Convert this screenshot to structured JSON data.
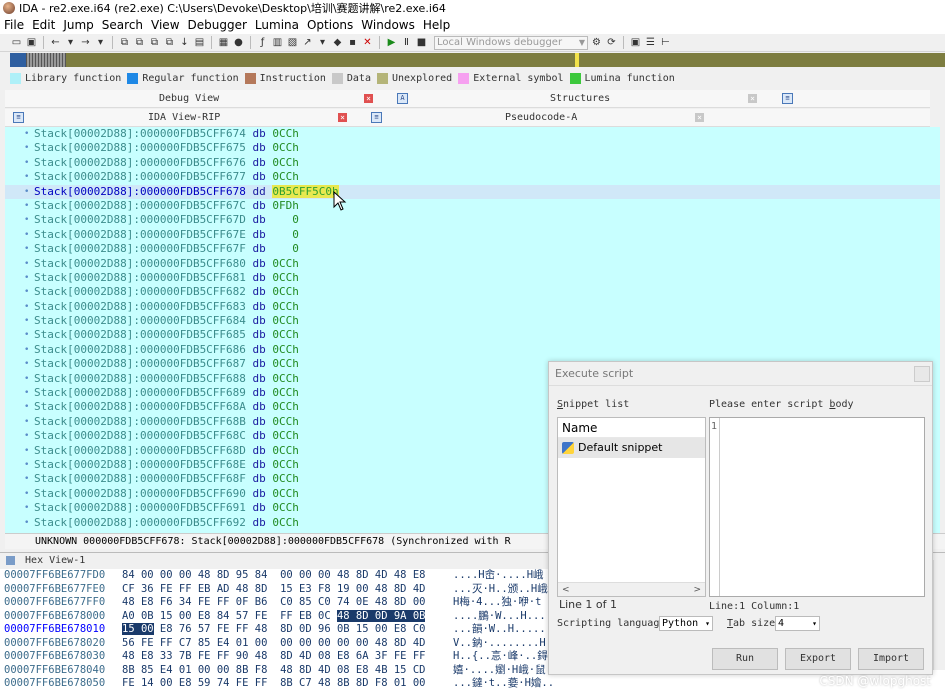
{
  "window": {
    "title": "IDA - re2.exe.i64 (re2.exe) C:\\Users\\Devoke\\Desktop\\培训\\赛题讲解\\re2.exe.i64"
  },
  "menu": [
    "File",
    "Edit",
    "Jump",
    "Search",
    "View",
    "Debugger",
    "Lumina",
    "Options",
    "Windows",
    "Help"
  ],
  "toolbar": {
    "debugger_select": "Local Windows debugger"
  },
  "legend": [
    {
      "label": "Library function",
      "color": "#aef0f8"
    },
    {
      "label": "Regular function",
      "color": "#1e88e5"
    },
    {
      "label": "Instruction",
      "color": "#b4785a"
    },
    {
      "label": "Data",
      "color": "#c8c8c8"
    },
    {
      "label": "Unexplored",
      "color": "#b4b478"
    },
    {
      "label": "External symbol",
      "color": "#f6a0f0"
    },
    {
      "label": "Lumina function",
      "color": "#3cc83c"
    }
  ],
  "tabs_top": {
    "debug_view": "Debug View",
    "structures": "Structures"
  },
  "tabs_second": {
    "ida_view": "IDA View-RIP",
    "pseudocode": "Pseudocode-A"
  },
  "ida_lines": [
    {
      "addr": "Stack[00002D88]:000000FDB5CFF674",
      "op": "db",
      "val": "0CCh"
    },
    {
      "addr": "Stack[00002D88]:000000FDB5CFF675",
      "op": "db",
      "val": "0CCh"
    },
    {
      "addr": "Stack[00002D88]:000000FDB5CFF676",
      "op": "db",
      "val": "0CCh"
    },
    {
      "addr": "Stack[00002D88]:000000FDB5CFF677",
      "op": "db",
      "val": "0CCh"
    },
    {
      "addr": "Stack[00002D88]:000000FDB5CFF678",
      "op": "dd",
      "val": "0B5CFF5C0h"
    },
    {
      "addr": "Stack[00002D88]:000000FDB5CFF67C",
      "op": "db",
      "val": "0FDh"
    },
    {
      "addr": "Stack[00002D88]:000000FDB5CFF67D",
      "op": "db",
      "val": "   0"
    },
    {
      "addr": "Stack[00002D88]:000000FDB5CFF67E",
      "op": "db",
      "val": "   0"
    },
    {
      "addr": "Stack[00002D88]:000000FDB5CFF67F",
      "op": "db",
      "val": "   0"
    },
    {
      "addr": "Stack[00002D88]:000000FDB5CFF680",
      "op": "db",
      "val": "0CCh"
    },
    {
      "addr": "Stack[00002D88]:000000FDB5CFF681",
      "op": "db",
      "val": "0CCh"
    },
    {
      "addr": "Stack[00002D88]:000000FDB5CFF682",
      "op": "db",
      "val": "0CCh"
    },
    {
      "addr": "Stack[00002D88]:000000FDB5CFF683",
      "op": "db",
      "val": "0CCh"
    },
    {
      "addr": "Stack[00002D88]:000000FDB5CFF684",
      "op": "db",
      "val": "0CCh"
    },
    {
      "addr": "Stack[00002D88]:000000FDB5CFF685",
      "op": "db",
      "val": "0CCh"
    },
    {
      "addr": "Stack[00002D88]:000000FDB5CFF686",
      "op": "db",
      "val": "0CCh"
    },
    {
      "addr": "Stack[00002D88]:000000FDB5CFF687",
      "op": "db",
      "val": "0CCh"
    },
    {
      "addr": "Stack[00002D88]:000000FDB5CFF688",
      "op": "db",
      "val": "0CCh"
    },
    {
      "addr": "Stack[00002D88]:000000FDB5CFF689",
      "op": "db",
      "val": "0CCh"
    },
    {
      "addr": "Stack[00002D88]:000000FDB5CFF68A",
      "op": "db",
      "val": "0CCh"
    },
    {
      "addr": "Stack[00002D88]:000000FDB5CFF68B",
      "op": "db",
      "val": "0CCh"
    },
    {
      "addr": "Stack[00002D88]:000000FDB5CFF68C",
      "op": "db",
      "val": "0CCh"
    },
    {
      "addr": "Stack[00002D88]:000000FDB5CFF68D",
      "op": "db",
      "val": "0CCh"
    },
    {
      "addr": "Stack[00002D88]:000000FDB5CFF68E",
      "op": "db",
      "val": "0CCh"
    },
    {
      "addr": "Stack[00002D88]:000000FDB5CFF68F",
      "op": "db",
      "val": "0CCh"
    },
    {
      "addr": "Stack[00002D88]:000000FDB5CFF690",
      "op": "db",
      "val": "0CCh"
    },
    {
      "addr": "Stack[00002D88]:000000FDB5CFF691",
      "op": "db",
      "val": "0CCh"
    },
    {
      "addr": "Stack[00002D88]:000000FDB5CFF692",
      "op": "db",
      "val": "0CCh"
    }
  ],
  "ida_status": "UNKNOWN 000000FDB5CFF678: Stack[00002D88]:000000FDB5CFF678 (Synchronized with R",
  "hex_title": "Hex View-1",
  "hex_lines": [
    {
      "addr": "00007FF6BE677FD0",
      "b1": "84 00 00 00 48 8D 95 84",
      "b2": "00 00 00 48 8D 4D 48 E8",
      "ascii": "....H峹·....H峨"
    },
    {
      "addr": "00007FF6BE677FE0",
      "b1": "CF 36 FE FF EB AD 48 8D",
      "b2": "15 E3 F8 19 00 48 8D 4D",
      "ascii": "...灭·H..颁..H峨"
    },
    {
      "addr": "00007FF6BE677FF0",
      "b1": "48 E8 F6 34 FE FF 0F B6",
      "b2": "C0 85 C0 74 0E 48 8D 00",
      "ascii": "H梅·4...独·咿·t"
    },
    {
      "addr": "00007FF6BE678000",
      "b1": "A0 0B 15 00 E8 84 57 FE",
      "b2": "FF EB 0C 48 8D 0D 9A 0B",
      "ascii": "....鵬·W...H..."
    },
    {
      "addr": "00007FF6BE678010",
      "b1": "15 00 E8 76 57 FE FF 48",
      "b2": "8D 0D 96 0B 15 00 E8 C0",
      "ascii": "...韻·W..H......"
    },
    {
      "addr": "00007FF6BE678020",
      "b1": "56 FE FF C7 85 E4 01 00",
      "b2": "00 00 00 00 00 48 8D 4D",
      "ascii": "V..鈉·........H"
    },
    {
      "addr": "00007FF6BE678030",
      "b1": "48 E8 33 7B FE FF 90 48",
      "b2": "8D 4D 08 E8 6A 3F FE FF",
      "ascii": "H..{..悥·峰·..鍀"
    },
    {
      "addr": "00007FF6BE678040",
      "b1": "8B 85 E4 01 00 00 8B F8",
      "b2": "48 8D 4D 08 E8 4B 15 CD",
      "ascii": "嬉·....嬼·H峨·鼠"
    },
    {
      "addr": "00007FF6BE678050",
      "b1": "FE 14 00 E8 59 74 FE FF",
      "b2": "8B C7 48 8B 8D F8 01 00",
      "ascii": "...鐽·t..嬊·H嬒.."
    }
  ],
  "dialog": {
    "title": "Execute script",
    "snippet_list_label": "Snippet list",
    "snippet_list_accel": "S",
    "snippet_list_rest": "nippet list",
    "body_label_a": "Please enter script ",
    "body_label_accel": "b",
    "body_label_b": "ody",
    "list_header": "Name",
    "snippet_item": "Default snippet",
    "line_gutter": "1",
    "line_of": "Line 1 of 1",
    "cursor_pos": "Line:1  Column:1",
    "language_label": "Scripting language",
    "language_value": "Python",
    "tab_label_accel": "T",
    "tab_label_rest": "ab size",
    "tab_value": "4",
    "btn_run": "Run",
    "btn_export": "Export",
    "btn_import": "Import"
  },
  "watermark": "CSDN @wlopghost"
}
